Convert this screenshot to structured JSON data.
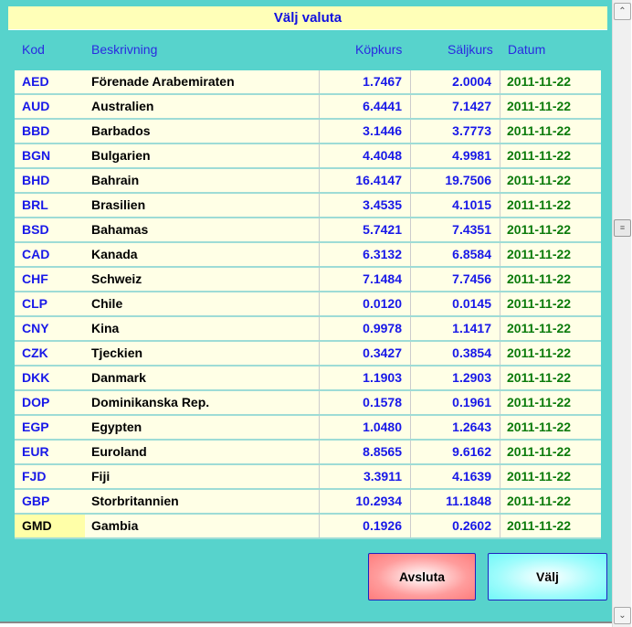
{
  "title": "Välj valuta",
  "headers": {
    "kod": "Kod",
    "beskrivning": "Beskrivning",
    "kopkurs": "Köpkurs",
    "saljkurs": "Säljkurs",
    "datum": "Datum"
  },
  "rows": [
    [
      "AED",
      "Förenade Arabemiraten",
      "1.7467",
      "2.0004",
      "2011-11-22"
    ],
    [
      "AUD",
      "Australien",
      "6.4441",
      "7.1427",
      "2011-11-22"
    ],
    [
      "BBD",
      "Barbados",
      "3.1446",
      "3.7773",
      "2011-11-22"
    ],
    [
      "BGN",
      "Bulgarien",
      "4.4048",
      "4.9981",
      "2011-11-22"
    ],
    [
      "BHD",
      "Bahrain",
      "16.4147",
      "19.7506",
      "2011-11-22"
    ],
    [
      "BRL",
      "Brasilien",
      "3.4535",
      "4.1015",
      "2011-11-22"
    ],
    [
      "BSD",
      "Bahamas",
      "5.7421",
      "7.4351",
      "2011-11-22"
    ],
    [
      "CAD",
      "Kanada",
      "6.3132",
      "6.8584",
      "2011-11-22"
    ],
    [
      "CHF",
      "Schweiz",
      "7.1484",
      "7.7456",
      "2011-11-22"
    ],
    [
      "CLP",
      "Chile",
      "0.0120",
      "0.0145",
      "2011-11-22"
    ],
    [
      "CNY",
      "Kina",
      "0.9978",
      "1.1417",
      "2011-11-22"
    ],
    [
      "CZK",
      "Tjeckien",
      "0.3427",
      "0.3854",
      "2011-11-22"
    ],
    [
      "DKK",
      "Danmark",
      "1.1903",
      "1.2903",
      "2011-11-22"
    ],
    [
      "DOP",
      "Dominikanska Rep.",
      "0.1578",
      "0.1961",
      "2011-11-22"
    ],
    [
      "EGP",
      "Egypten",
      "1.0480",
      "1.2643",
      "2011-11-22"
    ],
    [
      "EUR",
      "Euroland",
      "8.8565",
      "9.6162",
      "2011-11-22"
    ],
    [
      "FJD",
      "Fiji",
      "3.3911",
      "4.1639",
      "2011-11-22"
    ],
    [
      "GBP",
      "Storbritannien",
      "10.2934",
      "11.1848",
      "2011-11-22"
    ],
    [
      "GMD",
      "Gambia",
      "0.1926",
      "0.2602",
      "2011-11-22"
    ]
  ],
  "selected_row": 18,
  "buttons": {
    "avsluta": "Avsluta",
    "valj": "Välj"
  },
  "scrollbar": {
    "up_icon": "chevron-up",
    "down_icon": "chevron-down",
    "position": 0.35
  }
}
